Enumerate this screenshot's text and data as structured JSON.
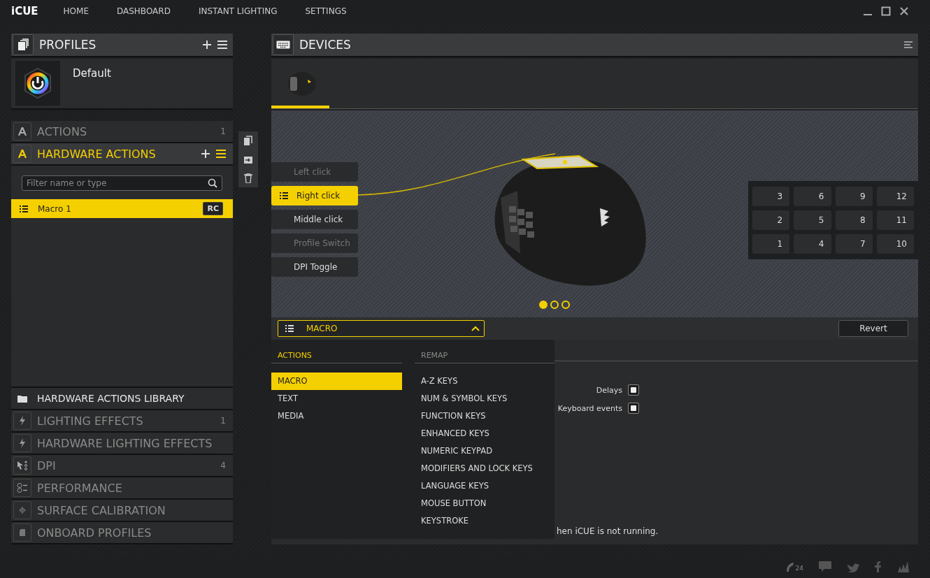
{
  "app": {
    "logo": "iCUE"
  },
  "nav": [
    {
      "label": "HOME",
      "selected": false
    },
    {
      "label": "DASHBOARD",
      "selected": false
    },
    {
      "label": "INSTANT LIGHTING",
      "selected": false
    },
    {
      "label": "SETTINGS",
      "selected": false
    }
  ],
  "profiles": {
    "title": "PROFILES",
    "items": [
      {
        "name": "Default"
      }
    ]
  },
  "sections": [
    {
      "title": "ACTIONS",
      "count": "1",
      "expanded": false
    },
    {
      "title": "HARDWARE ACTIONS",
      "expanded": true,
      "filter_placeholder": "Filter name or type",
      "items": [
        {
          "name": "Macro 1",
          "badge": "RC",
          "selected": true
        }
      ]
    },
    {
      "title": "HARDWARE ACTIONS LIBRARY",
      "expanded": false
    },
    {
      "title": "LIGHTING EFFECTS",
      "count": "1",
      "expanded": false
    },
    {
      "title": "HARDWARE LIGHTING EFFECTS",
      "expanded": false
    },
    {
      "title": "DPI",
      "count": "4",
      "expanded": false
    },
    {
      "title": "PERFORMANCE",
      "expanded": false
    },
    {
      "title": "SURFACE CALIBRATION",
      "expanded": false
    },
    {
      "title": "ONBOARD PROFILES",
      "expanded": false
    }
  ],
  "devices": {
    "title": "DEVICES",
    "items": [
      {
        "selected": true
      }
    ]
  },
  "mouse_buttons": [
    {
      "label": "Left click",
      "selected": false,
      "disabled": true
    },
    {
      "label": "Right click",
      "selected": true,
      "disabled": false
    },
    {
      "label": "Middle click",
      "selected": false,
      "disabled": false
    },
    {
      "label": "Profile Switch",
      "selected": false,
      "disabled": true
    },
    {
      "label": "DPI Toggle",
      "selected": false,
      "disabled": false
    }
  ],
  "keypad": [
    [
      "3",
      "6",
      "9",
      "12"
    ],
    [
      "2",
      "5",
      "8",
      "11"
    ],
    [
      "1",
      "4",
      "7",
      "10"
    ]
  ],
  "pages": [
    {
      "selected": true
    },
    {
      "selected": false
    },
    {
      "selected": false
    }
  ],
  "action_type": {
    "value": "MACRO",
    "expanded": true
  },
  "revert_button": "Revert",
  "options": [
    {
      "label": "Delays",
      "checked": true
    },
    {
      "label": "Keyboard events",
      "checked": true
    }
  ],
  "note": "hen iCUE is not running.",
  "footer": {
    "support_hours": "24"
  },
  "dropdown": {
    "columns": [
      {
        "title": "ACTIONS",
        "items": [
          {
            "label": "MACRO",
            "selected": true
          },
          {
            "label": "TEXT",
            "selected": false
          },
          {
            "label": "MEDIA",
            "selected": false
          }
        ]
      },
      {
        "title": "REMAP",
        "items": [
          {
            "label": "A-Z KEYS",
            "selected": false
          },
          {
            "label": "NUM & SYMBOL KEYS",
            "selected": false
          },
          {
            "label": "FUNCTION KEYS",
            "selected": false
          },
          {
            "label": "ENHANCED KEYS",
            "selected": false
          },
          {
            "label": "NUMERIC KEYPAD",
            "selected": false
          },
          {
            "label": "MODIFIERS AND LOCK KEYS",
            "selected": false
          },
          {
            "label": "LANGUAGE KEYS",
            "selected": false
          },
          {
            "label": "MOUSE BUTTON",
            "selected": false
          },
          {
            "label": "KEYSTROKE",
            "selected": false
          }
        ]
      }
    ]
  }
}
